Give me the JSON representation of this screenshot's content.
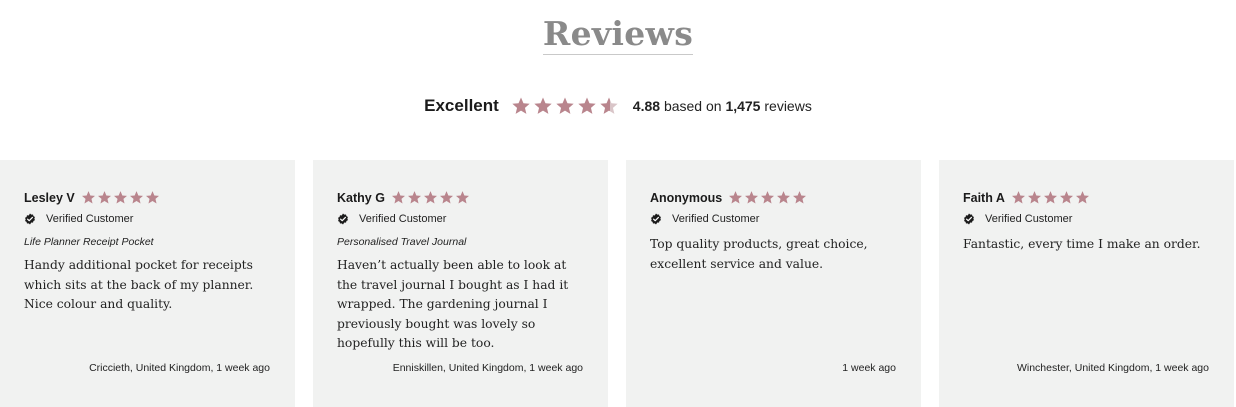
{
  "section": {
    "title": "Reviews"
  },
  "summary": {
    "rating_label": "Excellent",
    "score": "4.88",
    "based_on_text": "based on",
    "count": "1,475",
    "reviews_word": "reviews",
    "star_rating": 4.88
  },
  "colors": {
    "star": "#b9858d",
    "card_bg": "#f1f2f1",
    "title": "#8a8a8a"
  },
  "reviews": [
    {
      "name": "Lesley V",
      "stars": 5,
      "verified": "Verified Customer",
      "product": "Life Planner Receipt Pocket",
      "text": "Handy additional pocket for receipts which sits at the back of my planner. Nice colour and quality.",
      "meta": "Criccieth, United Kingdom, 1 week ago"
    },
    {
      "name": "Kathy G",
      "stars": 5,
      "verified": "Verified Customer",
      "product": "Personalised Travel Journal",
      "text": "Haven’t actually been able to look at the travel journal I bought as I had it wrapped. The gardening journal I previously bought was lovely so hopefully this will be too.",
      "meta": "Enniskillen, United Kingdom, 1 week ago"
    },
    {
      "name": "Anonymous",
      "stars": 5,
      "verified": "Verified Customer",
      "product": "",
      "text": "Top quality products, great choice, excellent service and value.",
      "meta": "1 week ago"
    },
    {
      "name": "Faith A",
      "stars": 5,
      "verified": "Verified Customer",
      "product": "",
      "text": "Fantastic, every time I make an order.",
      "meta": "Winchester, United Kingdom, 1 week ago"
    }
  ]
}
